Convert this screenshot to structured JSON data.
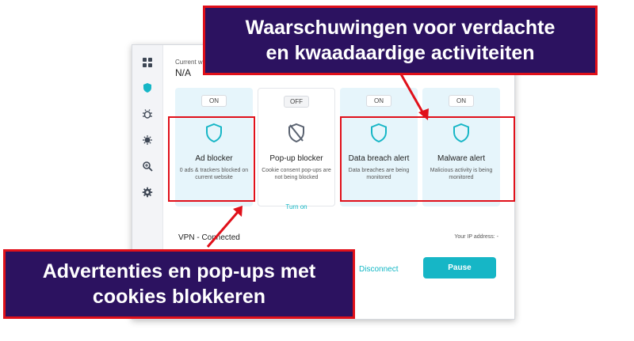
{
  "app": {
    "current_website_label": "Current website",
    "current_website_value": "N/A",
    "sidebar_icons": [
      "grid-icon",
      "shield-icon",
      "bug-icon",
      "virus-icon",
      "search-zoom-icon",
      "gear-icon"
    ],
    "cards": [
      {
        "status": "ON",
        "title": "Ad blocker",
        "description": "0 ads & trackers blocked on current website",
        "icon": "shield-icon",
        "enabled": true
      },
      {
        "status": "OFF",
        "title": "Pop-up blocker",
        "description": "Cookie consent pop-ups are not being blocked",
        "icon": "shield-off-icon",
        "enabled": false,
        "action": "Turn on"
      },
      {
        "status": "ON",
        "title": "Data breach alert",
        "description": "Data breaches are being monitored",
        "icon": "shield-icon",
        "enabled": true
      },
      {
        "status": "ON",
        "title": "Malware alert",
        "description": "Malicious activity is being monitored",
        "icon": "shield-icon",
        "enabled": true
      }
    ],
    "vpn_status": "VPN - Connected",
    "ip_label": "Your IP address: -",
    "disconnect_label": "Disconnect",
    "pause_label": "Pause"
  },
  "callouts": {
    "top": {
      "line1": "Waarschuwingen voor verdachte",
      "line2": "en kwaadaardige activiteiten"
    },
    "bottom": {
      "line1": "Advertenties en pop-ups met",
      "line2": "cookies blokkeren"
    }
  },
  "colors": {
    "accent": "#16b6c6",
    "card_on_bg": "#e6f5fb",
    "callout_bg": "#2c1260",
    "highlight_red": "#e0101a"
  }
}
